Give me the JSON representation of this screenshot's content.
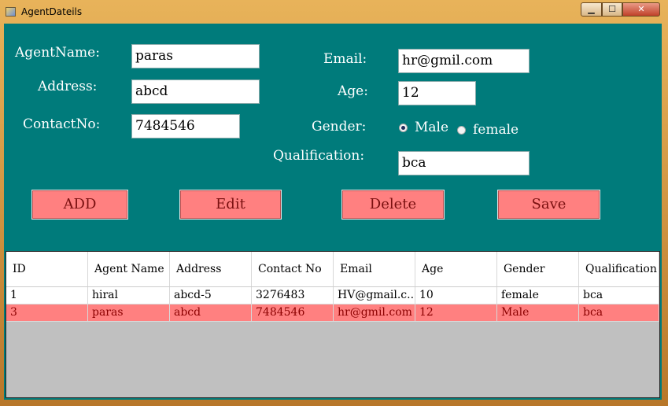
{
  "window": {
    "title": "AgentDateils",
    "min_glyph": "▁",
    "max_glyph": "☐",
    "close_glyph": "✕"
  },
  "form": {
    "agent_name": {
      "label": "AgentName:",
      "value": "paras"
    },
    "address": {
      "label": "Address:",
      "value": "abcd"
    },
    "contact": {
      "label": "ContactNo:",
      "value": "7484546"
    },
    "email": {
      "label": "Email:",
      "value": "hr@gmil.com"
    },
    "age": {
      "label": "Age:",
      "value": "12"
    },
    "gender": {
      "label": "Gender:",
      "options": [
        "Male",
        "female"
      ],
      "selected": "Male"
    },
    "qualification": {
      "label": "Qualification:",
      "value": "bca"
    }
  },
  "buttons": {
    "add": "ADD",
    "edit": "Edit",
    "delete": "Delete",
    "save": "Save"
  },
  "grid": {
    "headers": [
      "ID",
      "Agent Name",
      "Address",
      "Contact No",
      "Email",
      "Age",
      "Gender",
      "Qualification"
    ],
    "rows": [
      [
        "1",
        "hiral",
        "abcd-5",
        "3276483",
        "HV@gmail.c...",
        "10",
        "female",
        "bca"
      ],
      [
        "3",
        "paras",
        "abcd",
        "7484546",
        "hr@gmil.com",
        "12",
        "Male",
        "bca"
      ]
    ],
    "selected_row": 1
  },
  "colors": {
    "form_background": "#007b7b",
    "button_background": "#ff8080",
    "selected_row": "#ff8080",
    "grid_empty": "#c0c0c0"
  }
}
